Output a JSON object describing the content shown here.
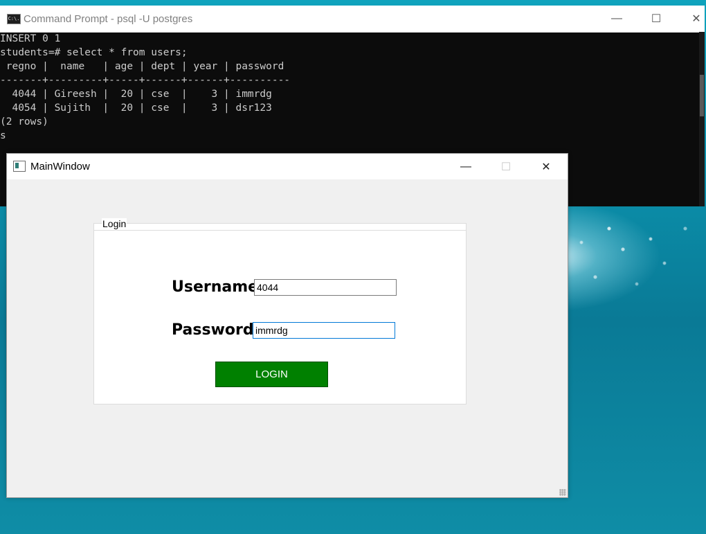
{
  "cmd_window": {
    "title": "Command Prompt - psql  -U postgres",
    "icon_text": "C:\\.",
    "controls": {
      "minimize": "—",
      "maximize": "☐",
      "close": "✕"
    },
    "lines": [
      "INSERT 0 1",
      "students=# select * from users;",
      " regno |  name   | age | dept | year | password",
      "-------+---------+-----+------+------+----------",
      "  4044 | Gireesh |  20 | cse  |    3 | immrdg",
      "  4054 | Sujith  |  20 | cse  |    3 | dsr123",
      "(2 rows)",
      "",
      "",
      "s"
    ]
  },
  "main_window": {
    "title": "MainWindow",
    "controls": {
      "minimize": "—",
      "maximize": "☐",
      "close": "✕"
    },
    "login_group": {
      "title": "Login",
      "username_label": "Username",
      "username_value": "4044",
      "password_label": "Password",
      "password_value": "immrdg",
      "login_button": "LOGIN"
    }
  },
  "colors": {
    "login_button": "#008000",
    "focus_border": "#0078d7",
    "terminal_bg": "#0c0c0c",
    "terminal_fg": "#cccccc"
  }
}
